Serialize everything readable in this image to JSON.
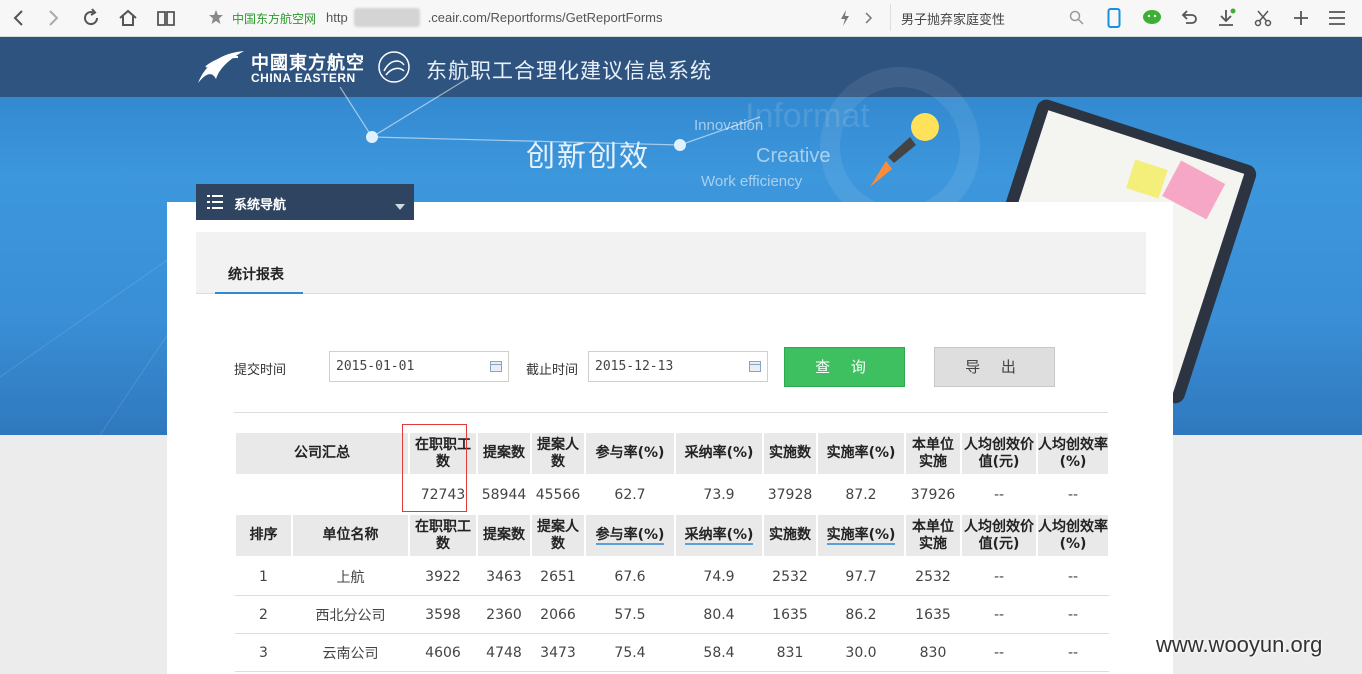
{
  "browser": {
    "site_name": "中国东方航空网",
    "url_prefix": "http",
    "url_suffix": ".ceair.com/Reportforms/GetReportForms",
    "search_text": "男子抛弃家庭变性"
  },
  "banner": {
    "logo_cn": "中國東方航空",
    "logo_en": "CHINA EASTERN",
    "system_title": "东航职工合理化建议信息系统",
    "slogan": "创新创效",
    "words": {
      "innovation": "Innovation",
      "creative": "Creative",
      "work": "Work efficiency",
      "information": "Informat"
    }
  },
  "nav": {
    "label": "系统导航"
  },
  "tab": {
    "label": "统计报表"
  },
  "filters": {
    "start_label": "提交时间",
    "start_value": "2015-01-01",
    "end_label": "截止时间",
    "end_value": "2015-12-13",
    "query_button": "查 询",
    "export_button": "导 出"
  },
  "summary": {
    "headers": [
      "公司汇总",
      "在职职工数",
      "提案数",
      "提案人数",
      "参与率(%)",
      "采纳率(%)",
      "实施数",
      "实施率(%)",
      "本单位实施",
      "人均创效价值(元)",
      "人均创效率(%)"
    ],
    "row": [
      "",
      "72743",
      "58944",
      "45566",
      "62.7",
      "73.9",
      "37928",
      "87.2",
      "37926",
      "--",
      "--"
    ]
  },
  "detail": {
    "headers": [
      "排序",
      "单位名称",
      "在职职工数",
      "提案数",
      "提案人数",
      "参与率(%)",
      "采纳率(%)",
      "实施数",
      "实施率(%)",
      "本单位实施",
      "人均创效价值(元)",
      "人均创效率(%)"
    ],
    "rows": [
      [
        "1",
        "上航",
        "3922",
        "3463",
        "2651",
        "67.6",
        "74.9",
        "2532",
        "97.7",
        "2532",
        "--",
        "--"
      ],
      [
        "2",
        "西北分公司",
        "3598",
        "2360",
        "2066",
        "57.5",
        "80.4",
        "1635",
        "86.2",
        "1635",
        "--",
        "--"
      ],
      [
        "3",
        "云南公司",
        "4606",
        "4748",
        "3473",
        "75.4",
        "58.4",
        "831",
        "30.0",
        "830",
        "--",
        "--"
      ]
    ]
  },
  "watermark": "www.wooyun.org"
}
